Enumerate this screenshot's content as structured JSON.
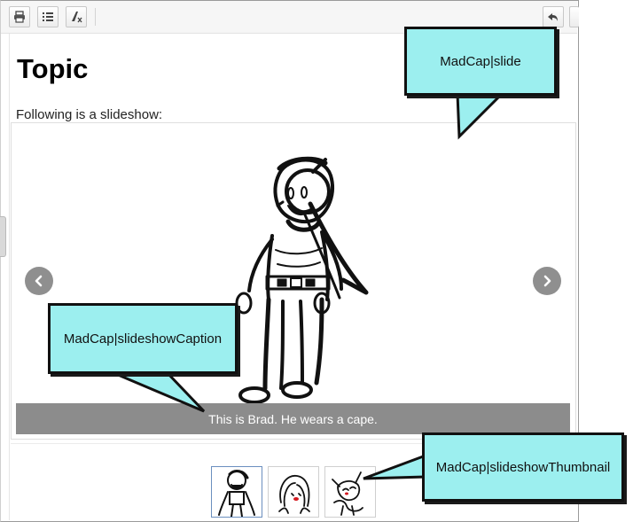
{
  "toolbar": {
    "icons": [
      "print-icon",
      "list-icon",
      "clear-formatting-icon",
      "undo-icon"
    ]
  },
  "topic": {
    "title": "Topic",
    "intro": "Following is a slideshow:"
  },
  "slideshow": {
    "caption": "This is Brad. He wears a cape.",
    "prev_icon": "chevron-left-icon",
    "next_icon": "chevron-right-icon",
    "thumbnails": [
      {
        "name": "thumbnail-brad",
        "active": true
      },
      {
        "name": "thumbnail-girl",
        "active": false
      },
      {
        "name": "thumbnail-cat",
        "active": false
      }
    ]
  },
  "callouts": {
    "slide": "MadCap|slide",
    "caption": "MadCap|slideshowCaption",
    "thumbnail": "MadCap|slideshowThumbnail"
  },
  "colors": {
    "callout_fill": "#9cefef",
    "caption_bar": "#8c8c8c",
    "nav_button": "#8f8f8f"
  }
}
